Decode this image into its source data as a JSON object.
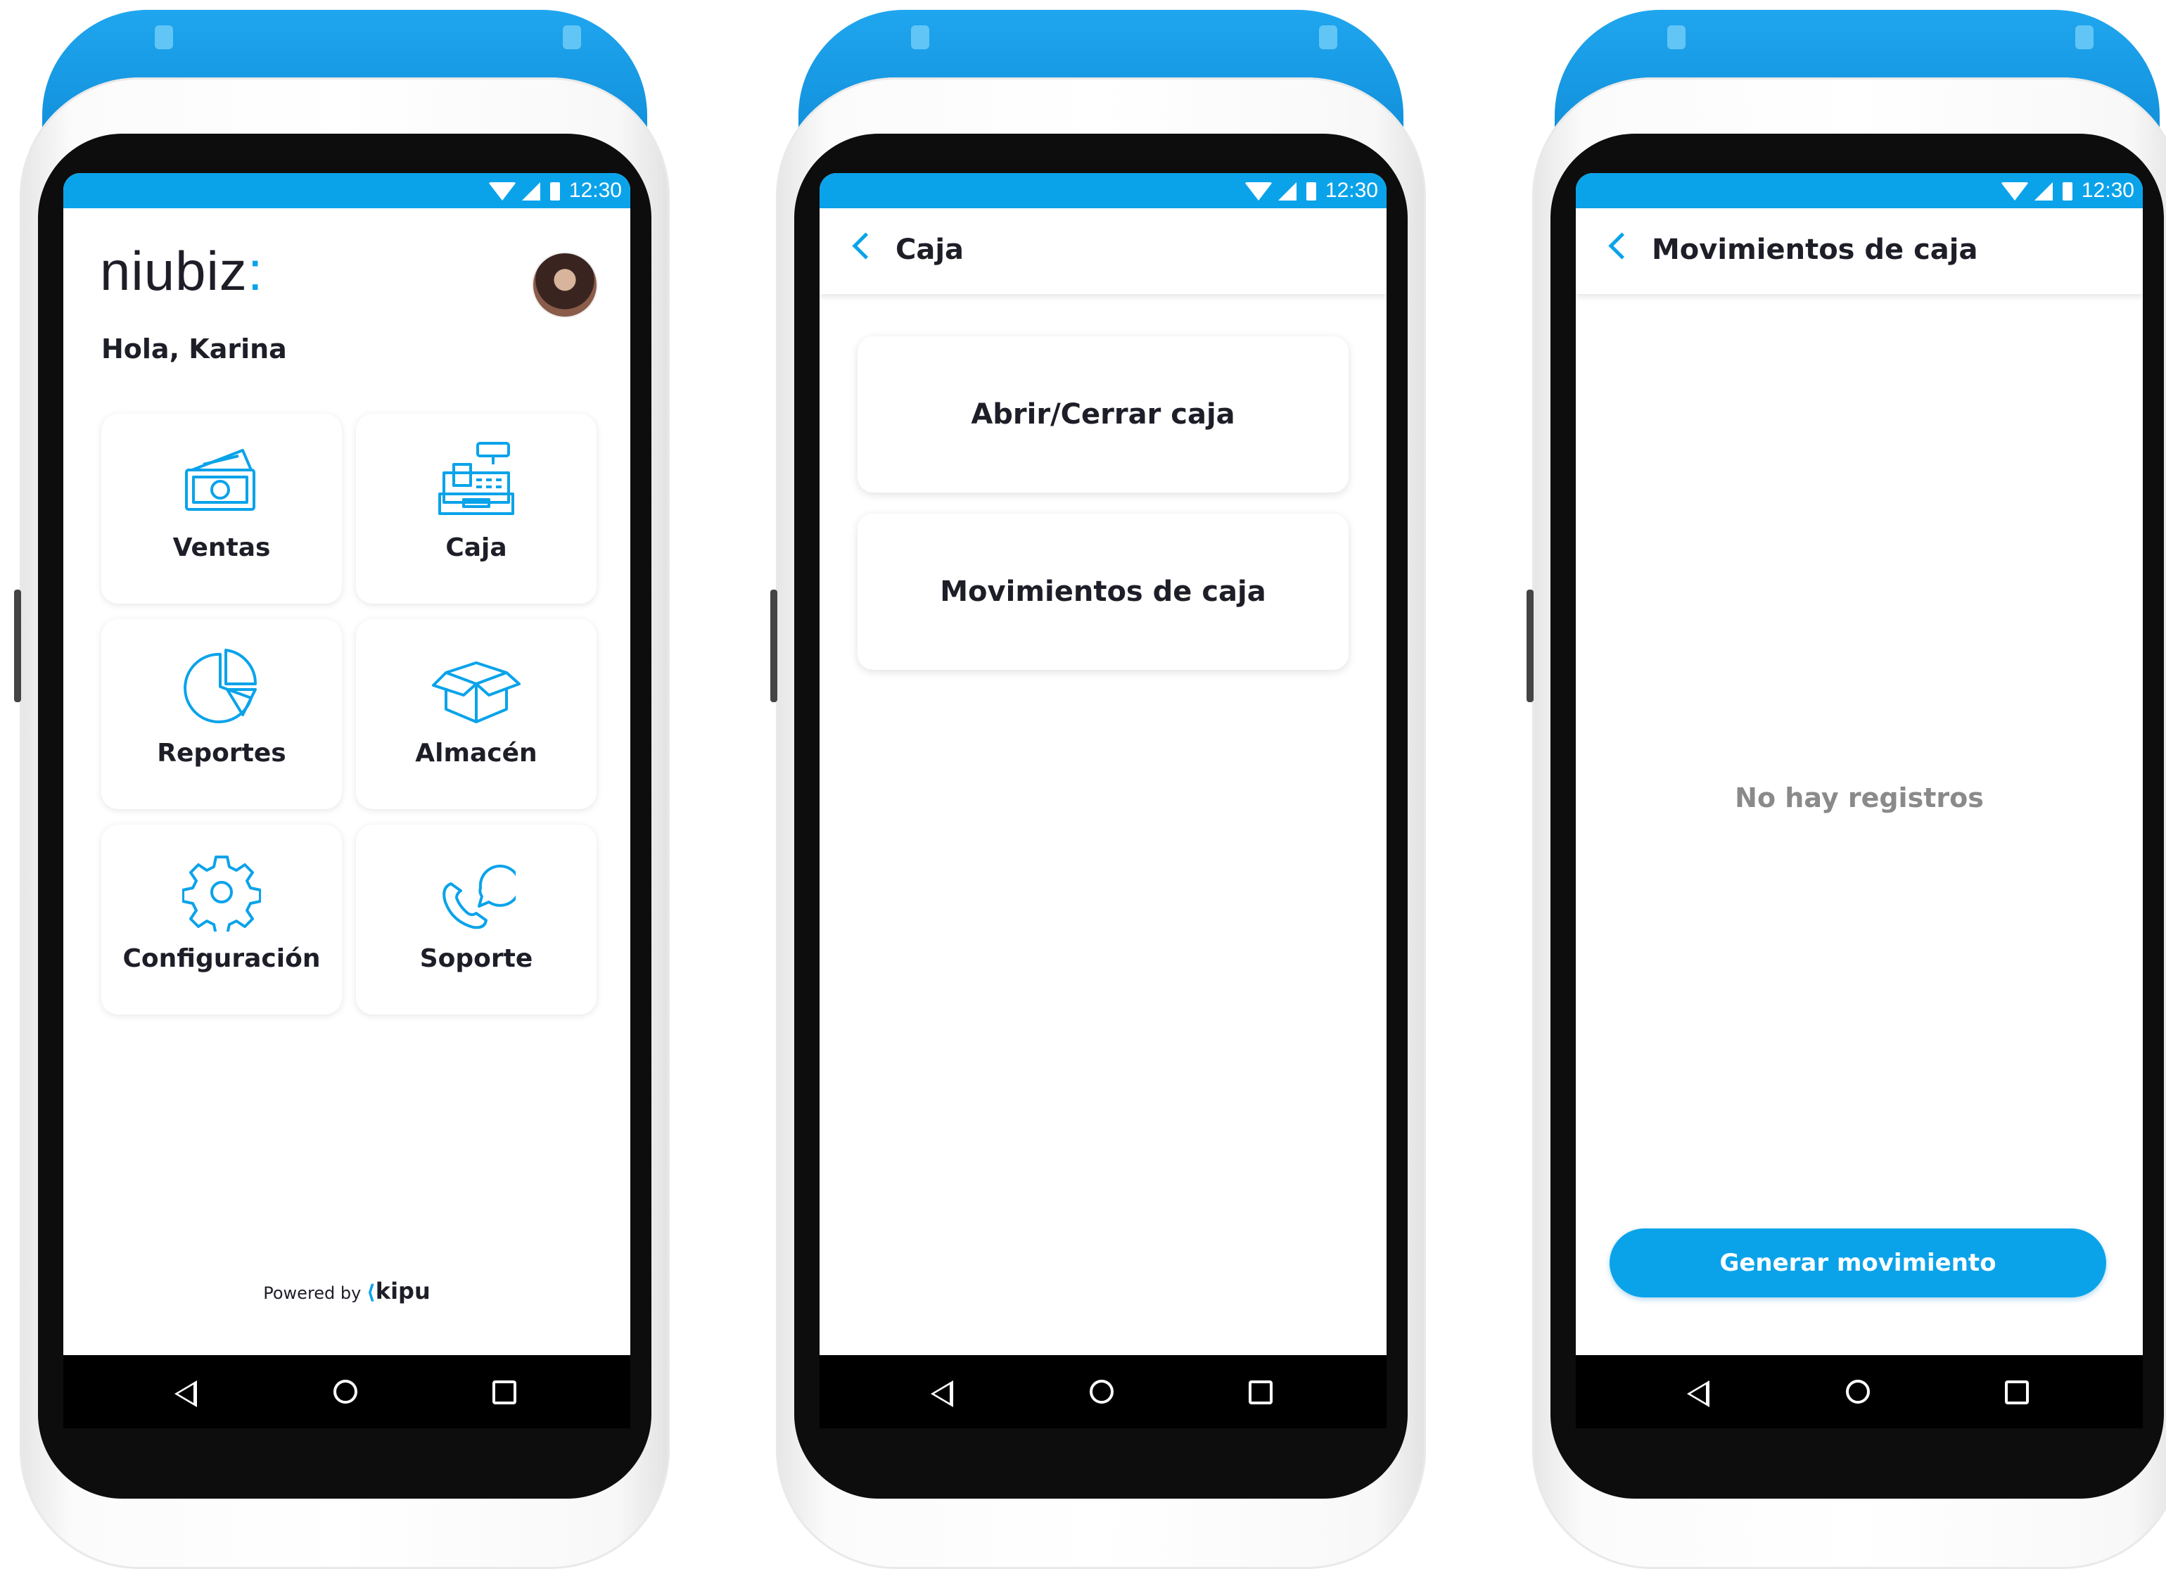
{
  "status_bar": {
    "time": "12:30"
  },
  "home": {
    "logo": "niubiz",
    "logo_colon": ":",
    "greeting": "Hola, Karina",
    "tiles": [
      {
        "label": "Ventas",
        "icon": "money-icon"
      },
      {
        "label": "Caja",
        "icon": "cash-register-icon"
      },
      {
        "label": "Reportes",
        "icon": "pie-chart-icon"
      },
      {
        "label": "Almacén",
        "icon": "box-icon"
      },
      {
        "label": "Configuración",
        "icon": "gear-icon"
      },
      {
        "label": "Soporte",
        "icon": "phone-chat-icon"
      }
    ],
    "powered_by": "Powered by",
    "powered_brand": "kipu"
  },
  "caja": {
    "title": "Caja",
    "options": [
      "Abrir/Cerrar caja",
      "Movimientos de caja"
    ]
  },
  "movimientos": {
    "title": "Movimientos de caja",
    "empty_text": "No hay registros",
    "cta": "Generar movimiento"
  },
  "colors": {
    "accent": "#0aa3ea",
    "text": "#1e1e28",
    "muted": "#8a8a8a",
    "device_cap": "#1a9be6"
  }
}
